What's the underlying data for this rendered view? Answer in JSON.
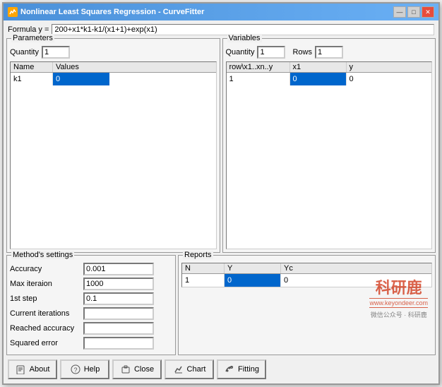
{
  "window": {
    "title": "Nonlinear Least Squares Regression - CurveFitter",
    "icon": "chart-icon"
  },
  "formula": {
    "label": "Formula y =",
    "value": "200+x1*k1-k1/(x1+1)+exp(x1)"
  },
  "parameters": {
    "group_title": "Parameters",
    "quantity_label": "Quantity",
    "quantity_value": "1",
    "columns": [
      "Name",
      "Values"
    ],
    "rows": [
      {
        "name": "k1",
        "values": "0",
        "selected": true
      }
    ]
  },
  "variables": {
    "group_title": "Variables",
    "quantity_label": "Quantity",
    "quantity_value": "1",
    "rows_label": "Rows",
    "rows_value": "1",
    "columns": [
      "row\\x1..xn..y",
      "x1",
      "y"
    ],
    "rows": [
      {
        "row": "1",
        "x1": "0",
        "y": "0",
        "x1_selected": true
      }
    ]
  },
  "methods": {
    "group_title": "Method's settings",
    "accuracy_label": "Accuracy",
    "accuracy_value": "0.001",
    "max_iteration_label": "Max iteraion",
    "max_iteration_value": "1000",
    "first_step_label": "1st step",
    "first_step_value": "0.1",
    "current_iterations_label": "Current iterations",
    "current_iterations_value": "",
    "reached_accuracy_label": "Reached accuracy",
    "reached_accuracy_value": "",
    "squared_error_label": "Squared error",
    "squared_error_value": ""
  },
  "reports": {
    "group_title": "Reports",
    "columns": [
      "N",
      "Y",
      "Yc"
    ],
    "rows": [
      {
        "n": "1",
        "Y": "0",
        "Yc": "0",
        "Y_selected": true
      }
    ]
  },
  "buttons": {
    "about_label": "About",
    "help_label": "Help",
    "close_label": "Close",
    "chart_label": "Chart",
    "fitting_label": "Fitting"
  },
  "title_buttons": {
    "minimize": "—",
    "maximize": "□",
    "close": "✕"
  },
  "watermark": {
    "text": "科研鹿",
    "url": "www.keyondeer.com",
    "subtitle": "微信公众号 · 科研鹿"
  }
}
